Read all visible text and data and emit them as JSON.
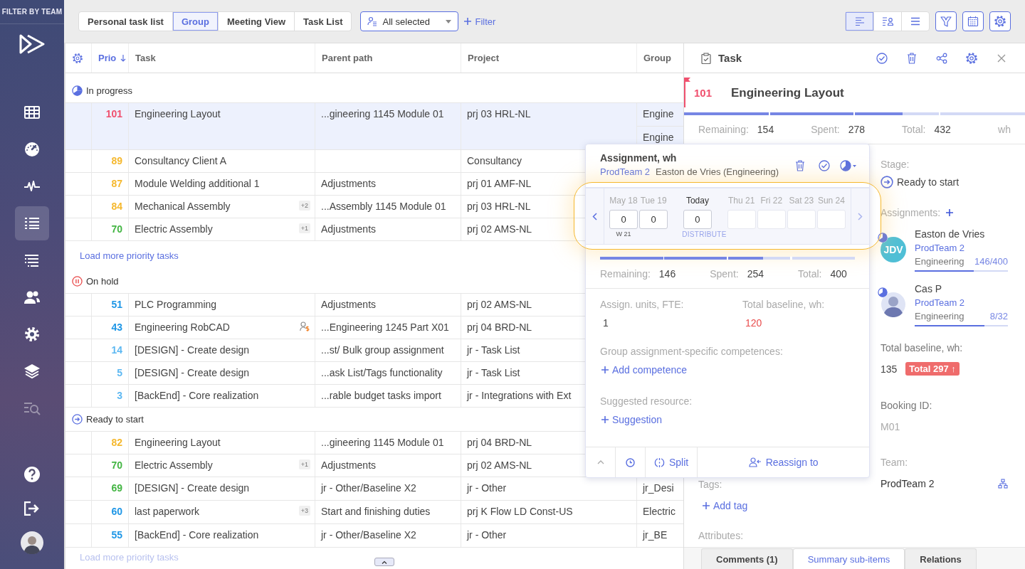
{
  "sidebar": {
    "header": "FILTER BY TEAM",
    "items": [
      {
        "kind": "grid",
        "selected": false,
        "disabled": false
      },
      {
        "kind": "gauge",
        "selected": false,
        "disabled": false
      },
      {
        "kind": "pulse",
        "selected": false,
        "disabled": false
      },
      {
        "kind": "list",
        "selected": true,
        "disabled": false
      },
      {
        "kind": "tree",
        "selected": false,
        "disabled": false
      },
      {
        "kind": "people",
        "selected": false,
        "disabled": false
      },
      {
        "kind": "settings",
        "selected": false,
        "disabled": false
      },
      {
        "kind": "layers",
        "selected": false,
        "disabled": false
      },
      {
        "kind": "chart-search",
        "selected": false,
        "disabled": true
      }
    ],
    "bottom": [
      {
        "kind": "help"
      },
      {
        "kind": "logout"
      },
      {
        "kind": "avatar"
      }
    ]
  },
  "toolbar": {
    "view_tabs": [
      {
        "label": "Personal task list",
        "selected": false
      },
      {
        "label": "Group",
        "selected": true
      },
      {
        "label": "Meeting View",
        "selected": false
      },
      {
        "label": "Task List",
        "selected": false
      }
    ],
    "team_select": {
      "value": "All selected"
    },
    "filter_link": "Filter",
    "layout_buttons": [
      {
        "kind": "list",
        "selected": true
      },
      {
        "kind": "list-people",
        "selected": false
      },
      {
        "kind": "lines",
        "selected": false
      }
    ],
    "tool_buttons": [
      {
        "kind": "funnel"
      },
      {
        "kind": "calendar"
      },
      {
        "kind": "settings"
      }
    ]
  },
  "table": {
    "columns": [
      {
        "label": "Prio",
        "sorted": true
      },
      {
        "label": "Task",
        "sorted": false
      },
      {
        "label": "Parent path",
        "sorted": false
      },
      {
        "label": "Project",
        "sorted": false
      },
      {
        "label": "Group",
        "sorted": false
      }
    ],
    "sections": [
      {
        "kind": "in-progress",
        "title": "In progress",
        "load_more": {
          "label": "Load more priority tasks",
          "dimmed": false
        },
        "rows": [
          {
            "prio": "101",
            "color": "#f0506e",
            "task": "Engineering Layout",
            "cost_icon": false,
            "parent": "...gineering 1145 Module 01",
            "project": "prj 03 HRL-NL",
            "groups": [
              "Engine",
              "Engine"
            ],
            "selected": true
          },
          {
            "prio": "89",
            "color": "#f5b82e",
            "task": "Consultancy Client A",
            "cost_icon": false,
            "project": "Consultancy",
            "selected": false
          },
          {
            "prio": "87",
            "color": "#f5b82e",
            "task": "Module Welding additional 1",
            "cost_icon": false,
            "parent": "Adjustments",
            "project": "prj 01 AMF-NL",
            "selected": false
          },
          {
            "prio": "84",
            "color": "#f5b82e",
            "task": "Mechanical Assembly",
            "badge": "+2",
            "cost_icon": false,
            "parent": "...Assembly 1145 Module 01",
            "project": "prj 03 HRL-NL",
            "selected": false
          },
          {
            "prio": "70",
            "color": "#43b543",
            "task": "Electric Assembly",
            "badge": "+1",
            "cost_icon": false,
            "parent": "Adjustments",
            "project": "prj 02 AMS-NL",
            "selected": false
          }
        ]
      },
      {
        "kind": "on-hold",
        "title": "On hold",
        "rows": [
          {
            "prio": "51",
            "color": "#1e96e6",
            "task": "PLC Programming",
            "cost_icon": false,
            "parent": "Adjustments",
            "project": "prj 02 AMS-NL",
            "selected": false
          },
          {
            "prio": "43",
            "color": "#1e96e6",
            "task": "Engineering RobCAD",
            "cost_icon": true,
            "parent": "...Engineering 1245 Part X01",
            "project": "prj 04 BRD-NL",
            "selected": false
          },
          {
            "prio": "14",
            "color": "#5db8f2",
            "task": "[DESIGN] - Create design",
            "cost_icon": false,
            "parent": "...st/ Bulk group assignment",
            "project": "jr - Task List",
            "selected": false
          },
          {
            "prio": "5",
            "color": "#5db8f2",
            "task": "[DESIGN] - Create design",
            "cost_icon": false,
            "parent": "...ask List/Tags functionality",
            "project": "jr - Task List",
            "selected": false
          },
          {
            "prio": "3",
            "color": "#5db8f2",
            "task": "[BackEnd] - Core realization",
            "cost_icon": false,
            "parent": "...rable budget tasks import",
            "project": "jr - Integrations with Ext",
            "selected": false
          }
        ]
      },
      {
        "kind": "ready",
        "title": "Ready to start",
        "load_more": {
          "label": "Load more priority tasks",
          "dimmed": true
        },
        "rows": [
          {
            "prio": "82",
            "color": "#f5b82e",
            "task": "Engineering Layout",
            "cost_icon": false,
            "parent": "...gineering 1145 Module 01",
            "project": "prj 04 BRD-NL",
            "selected": false
          },
          {
            "prio": "70",
            "color": "#43b543",
            "task": "Electric Assembly",
            "badge": "+1",
            "cost_icon": false,
            "parent": "Adjustments",
            "project": "prj 02 AMS-NL",
            "selected": false
          },
          {
            "prio": "69",
            "color": "#43b543",
            "task": "[DESIGN] - Create design",
            "cost_icon": false,
            "parent": "jr - Other/Baseline X2",
            "project": "jr - Other",
            "groups": [
              "jr_Desi"
            ],
            "selected": false
          },
          {
            "prio": "60",
            "color": "#1e96e6",
            "task": "last paperwork",
            "badge": "+3",
            "cost_icon": false,
            "parent": "Start and finishing duties",
            "project": "prj K Flow LD Const-US",
            "groups": [
              "Electric"
            ],
            "selected": false
          },
          {
            "prio": "55",
            "color": "#1e96e6",
            "task": "[BackEnd] - Core realization",
            "cost_icon": false,
            "parent": "jr - Other/Baseline X2",
            "project": "jr - Other",
            "groups": [
              "jr_BE"
            ],
            "selected": false
          }
        ]
      }
    ]
  },
  "detail": {
    "title": "Task",
    "prio": "101",
    "name": "Engineering Layout",
    "level": 0.64,
    "stats": [
      {
        "label": "Remaining:",
        "value": "154"
      },
      {
        "label": "Spent:",
        "value": "278"
      },
      {
        "label": "Total:",
        "value": "432"
      }
    ],
    "unit": "wh",
    "stage_label": "Stage:",
    "stage": {
      "kind": "ready",
      "label": "Ready to start"
    },
    "assignments_label": "Assignments:",
    "assignments": [
      {
        "kind": "initials",
        "initials": "JDV",
        "name": "Easton de Vries",
        "team": "ProdTeam 2",
        "role": "Engineering",
        "ratio": "146/400",
        "level": 0.63
      },
      {
        "kind": "picture",
        "name": "Cas P",
        "team": "ProdTeam 2",
        "role": "Engineering",
        "ratio": "8/32",
        "level": 0.75
      }
    ],
    "baseline_label": "Total baseline, wh:",
    "baseline": "135",
    "baseline_badge": "Total 297 ↑",
    "booking_label": "Booking ID:",
    "booking_id": "M01",
    "team_label": "Team:",
    "team": "ProdTeam 2",
    "tags_label": "Tags:",
    "add_tag": "Add tag",
    "attributes_label": "Attributes:",
    "tabs": [
      {
        "label": "Comments (1)",
        "selected": false
      },
      {
        "label": "Summary sub-items",
        "selected": true
      },
      {
        "label": "Relations",
        "selected": false
      }
    ]
  },
  "popup": {
    "title": "Assignment, wh",
    "team": "ProdTeam 2",
    "person": "Easton de Vries (Engineering)",
    "days": [
      {
        "label": "May 18",
        "value": "0",
        "note": "W 21",
        "today": false
      },
      {
        "label": "Tue 19",
        "value": "0",
        "today": false
      },
      {
        "label": "Today",
        "value": "0",
        "note": "DISTRIBUTE",
        "today": true
      },
      {
        "label": "Thu 21",
        "today": false
      },
      {
        "label": "Fri 22",
        "today": false
      },
      {
        "label": "Sat 23",
        "today": false
      },
      {
        "label": "Sun 24",
        "today": false
      }
    ],
    "level": 0.64,
    "stats": [
      {
        "label": "Remaining:",
        "value": "146"
      },
      {
        "label": "Spent:",
        "value": "254"
      },
      {
        "label": "Total:",
        "value": "400"
      }
    ],
    "units_label": "Assign. units, FTE:",
    "units": "1",
    "baseline_label": "Total baseline, wh:",
    "baseline": "120",
    "baseline_exceeded": true,
    "competences_label": "Group assignment-specific competences:",
    "add_competence": "Add competence",
    "suggested_label": "Suggested resource:",
    "suggestion": "Suggestion",
    "split": "Split",
    "reassign": "Reassign to"
  }
}
